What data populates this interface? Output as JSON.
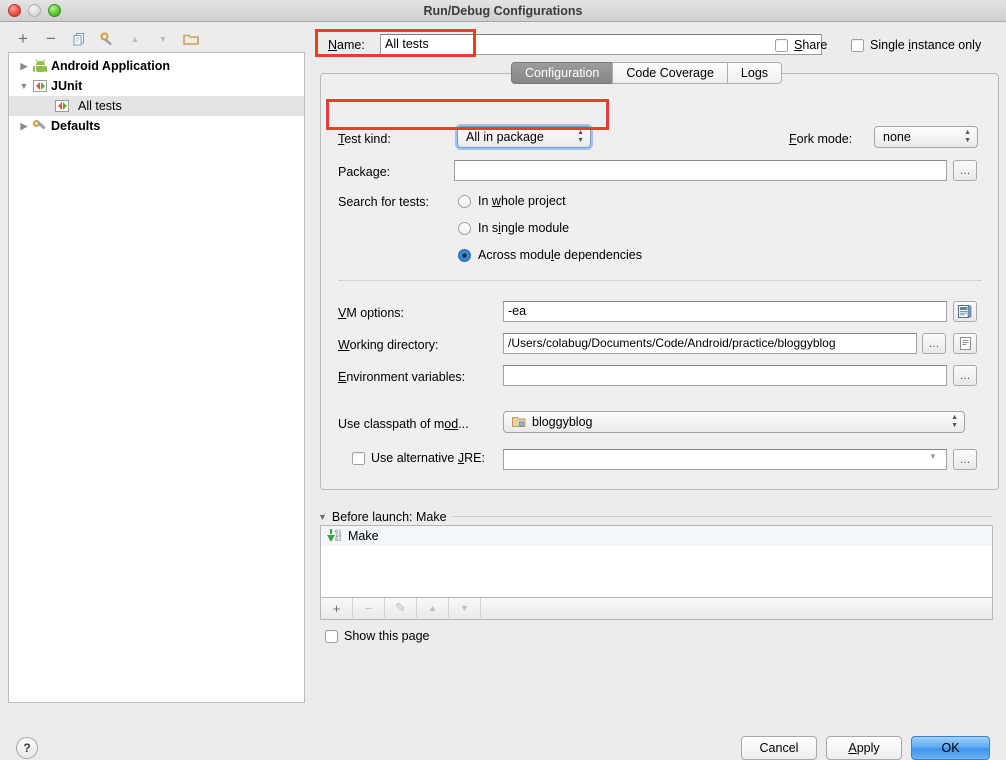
{
  "window": {
    "title": "Run/Debug Configurations"
  },
  "sidebar": {
    "toolbar": [
      {
        "name": "add-icon",
        "glyph": "+"
      },
      {
        "name": "remove-icon",
        "glyph": "−"
      },
      {
        "name": "copy-icon",
        "glyph": "❐"
      },
      {
        "name": "edit-defaults-icon",
        "glyph": "⚙"
      },
      {
        "name": "move-up-icon",
        "glyph": "▲"
      },
      {
        "name": "move-down-icon",
        "glyph": "▼"
      },
      {
        "name": "folder-icon",
        "glyph": "▢"
      }
    ],
    "tree": [
      {
        "label": "Android Application",
        "icon": "android-icon",
        "expanded": false,
        "level": 0,
        "selected": false
      },
      {
        "label": "JUnit",
        "icon": "junit-icon",
        "expanded": true,
        "level": 0,
        "selected": false
      },
      {
        "label": "All tests",
        "icon": "junit-icon",
        "level": 1,
        "selected": true
      },
      {
        "label": "Defaults",
        "icon": "defaults-icon",
        "expanded": false,
        "level": 0,
        "selected": false
      }
    ]
  },
  "header": {
    "name_label": "Name:",
    "name_value": "All tests",
    "share_label": "Share",
    "share_checked": false,
    "single_instance_label": "Single instance only",
    "single_instance_checked": false
  },
  "tabs": [
    {
      "label": "Configuration",
      "active": true
    },
    {
      "label": "Code Coverage",
      "active": false
    },
    {
      "label": "Logs",
      "active": false
    }
  ],
  "config": {
    "test_kind_label": "Test kind:",
    "test_kind_value": "All in package",
    "fork_mode_label": "Fork mode:",
    "fork_mode_value": "none",
    "package_label": "Package:",
    "package_value": "",
    "browse_glyph": "…",
    "search_label": "Search for tests:",
    "search_options": [
      {
        "label": "In whole project",
        "selected": false
      },
      {
        "label": "In single module",
        "selected": false
      },
      {
        "label": "Across module dependencies",
        "selected": true
      }
    ],
    "vm_options_label": "VM options:",
    "vm_options_value": "-ea",
    "working_dir_label": "Working directory:",
    "working_dir_value": "/Users/colabug/Documents/Code/Android/practice/bloggyblog",
    "env_vars_label": "Environment variables:",
    "env_vars_value": "",
    "classpath_label": "Use classpath of mod...",
    "classpath_value": "bloggyblog",
    "alt_jre_label": "Use alternative JRE:",
    "alt_jre_checked": false,
    "alt_jre_value": ""
  },
  "before_launch": {
    "title": "Before launch: Make",
    "items": [
      {
        "label": "Make",
        "icon": "make-icon"
      }
    ],
    "toolbar": [
      {
        "name": "add-task-icon",
        "glyph": "+",
        "enabled": true
      },
      {
        "name": "remove-task-icon",
        "glyph": "−",
        "enabled": false
      },
      {
        "name": "edit-task-icon",
        "glyph": "✎",
        "enabled": false
      },
      {
        "name": "move-task-up-icon",
        "glyph": "▲",
        "enabled": false
      },
      {
        "name": "move-task-down-icon",
        "glyph": "▼",
        "enabled": false
      }
    ],
    "show_page_label": "Show this page",
    "show_page_checked": false
  },
  "footer": {
    "help_glyph": "?",
    "cancel_label": "Cancel",
    "apply_label": "Apply",
    "ok_label": "OK"
  },
  "annotations": {
    "color": "#f03a2b",
    "boxes": [
      "name-field-highlight",
      "test-kind-highlight"
    ]
  }
}
